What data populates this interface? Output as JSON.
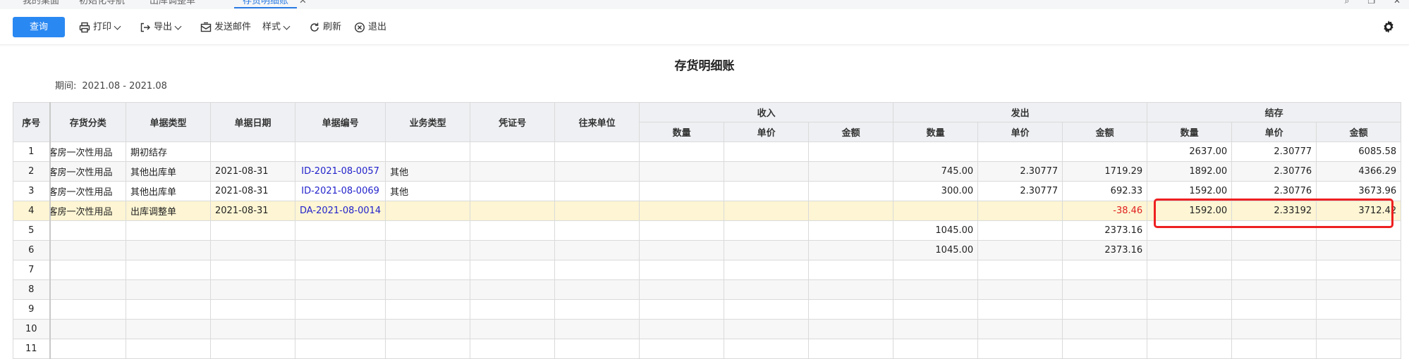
{
  "tabs": [
    {
      "label": "我的桌面",
      "active": false
    },
    {
      "label": "初始化导航",
      "active": false
    },
    {
      "label": "出库调整单",
      "active": false
    },
    {
      "label": "存货明细账",
      "active": true
    }
  ],
  "toolbar": {
    "query": "查询",
    "print": "打印",
    "export": "导出",
    "send_mail": "发送邮件",
    "style": "样式",
    "refresh": "刷新",
    "exit": "退出"
  },
  "report": {
    "title": "存货明细账",
    "period_label": "期间:",
    "period_value": "2021.08 - 2021.08"
  },
  "table": {
    "headers": {
      "seq": "序号",
      "category": "存货分类",
      "doc_type": "单据类型",
      "doc_date": "单据日期",
      "doc_no": "单据编号",
      "biz_type": "业务类型",
      "voucher": "凭证号",
      "partner": "往来单位",
      "income": "收入",
      "outgo": "发出",
      "balance": "结存",
      "qty": "数量",
      "price": "单价",
      "amount": "金额"
    },
    "rows": [
      {
        "seq": "1",
        "category": "客房一次性用品",
        "doc_type": "期初结存",
        "doc_date": "",
        "doc_no": "",
        "biz_type": "",
        "voucher": "",
        "partner": "",
        "in_qty": "",
        "in_price": "",
        "in_amt": "",
        "out_qty": "",
        "out_price": "",
        "out_amt": "",
        "bal_qty": "2637.00",
        "bal_price": "2.30777",
        "bal_amt": "6085.58"
      },
      {
        "seq": "2",
        "category": "客房一次性用品",
        "doc_type": "其他出库单",
        "doc_date": "2021-08-31",
        "doc_no": "ID-2021-08-0057",
        "biz_type": "其他",
        "voucher": "",
        "partner": "",
        "in_qty": "",
        "in_price": "",
        "in_amt": "",
        "out_qty": "745.00",
        "out_price": "2.30777",
        "out_amt": "1719.29",
        "bal_qty": "1892.00",
        "bal_price": "2.30776",
        "bal_amt": "4366.29"
      },
      {
        "seq": "3",
        "category": "客房一次性用品",
        "doc_type": "其他出库单",
        "doc_date": "2021-08-31",
        "doc_no": "ID-2021-08-0069",
        "biz_type": "其他",
        "voucher": "",
        "partner": "",
        "in_qty": "",
        "in_price": "",
        "in_amt": "",
        "out_qty": "300.00",
        "out_price": "2.30777",
        "out_amt": "692.33",
        "bal_qty": "1592.00",
        "bal_price": "2.30776",
        "bal_amt": "3673.96"
      },
      {
        "seq": "4",
        "category": "客房一次性用品",
        "doc_type": "出库调整单",
        "doc_date": "2021-08-31",
        "doc_no": "DA-2021-08-0014",
        "biz_type": "",
        "voucher": "",
        "partner": "",
        "in_qty": "",
        "in_price": "",
        "in_amt": "",
        "out_qty": "",
        "out_price": "",
        "out_amt": "-38.46",
        "bal_qty": "1592.00",
        "bal_price": "2.33192",
        "bal_amt": "3712.42"
      },
      {
        "seq": "5",
        "category": "",
        "doc_type": "",
        "doc_date": "",
        "doc_no": "",
        "biz_type": "",
        "voucher": "",
        "partner": "",
        "in_qty": "",
        "in_price": "",
        "in_amt": "",
        "out_qty": "1045.00",
        "out_price": "",
        "out_amt": "2373.16",
        "bal_qty": "",
        "bal_price": "",
        "bal_amt": ""
      },
      {
        "seq": "6",
        "category": "",
        "doc_type": "",
        "doc_date": "",
        "doc_no": "",
        "biz_type": "",
        "voucher": "",
        "partner": "",
        "in_qty": "",
        "in_price": "",
        "in_amt": "",
        "out_qty": "1045.00",
        "out_price": "",
        "out_amt": "2373.16",
        "bal_qty": "",
        "bal_price": "",
        "bal_amt": ""
      },
      {
        "seq": "7",
        "category": "",
        "doc_type": "",
        "doc_date": "",
        "doc_no": "",
        "biz_type": "",
        "voucher": "",
        "partner": "",
        "in_qty": "",
        "in_price": "",
        "in_amt": "",
        "out_qty": "",
        "out_price": "",
        "out_amt": "",
        "bal_qty": "",
        "bal_price": "",
        "bal_amt": ""
      },
      {
        "seq": "8",
        "category": "",
        "doc_type": "",
        "doc_date": "",
        "doc_no": "",
        "biz_type": "",
        "voucher": "",
        "partner": "",
        "in_qty": "",
        "in_price": "",
        "in_amt": "",
        "out_qty": "",
        "out_price": "",
        "out_amt": "",
        "bal_qty": "",
        "bal_price": "",
        "bal_amt": ""
      },
      {
        "seq": "9",
        "category": "",
        "doc_type": "",
        "doc_date": "",
        "doc_no": "",
        "biz_type": "",
        "voucher": "",
        "partner": "",
        "in_qty": "",
        "in_price": "",
        "in_amt": "",
        "out_qty": "",
        "out_price": "",
        "out_amt": "",
        "bal_qty": "",
        "bal_price": "",
        "bal_amt": ""
      },
      {
        "seq": "10",
        "category": "",
        "doc_type": "",
        "doc_date": "",
        "doc_no": "",
        "biz_type": "",
        "voucher": "",
        "partner": "",
        "in_qty": "",
        "in_price": "",
        "in_amt": "",
        "out_qty": "",
        "out_price": "",
        "out_amt": "",
        "bal_qty": "",
        "bal_price": "",
        "bal_amt": ""
      },
      {
        "seq": "11",
        "category": "",
        "doc_type": "",
        "doc_date": "",
        "doc_no": "",
        "biz_type": "",
        "voucher": "",
        "partner": "",
        "in_qty": "",
        "in_price": "",
        "in_amt": "",
        "out_qty": "",
        "out_price": "",
        "out_amt": "",
        "bal_qty": "",
        "bal_price": "",
        "bal_amt": ""
      }
    ],
    "highlight_row": "4",
    "negative_color": "#e02020",
    "link_color": "#2222cc"
  },
  "annotation": {
    "color": "#ee2020"
  },
  "icons": [
    "search-icon",
    "window-icon",
    "close-icon",
    "printer-icon",
    "export-icon",
    "mail-icon",
    "refresh-icon",
    "exit-icon",
    "gear-icon"
  ]
}
